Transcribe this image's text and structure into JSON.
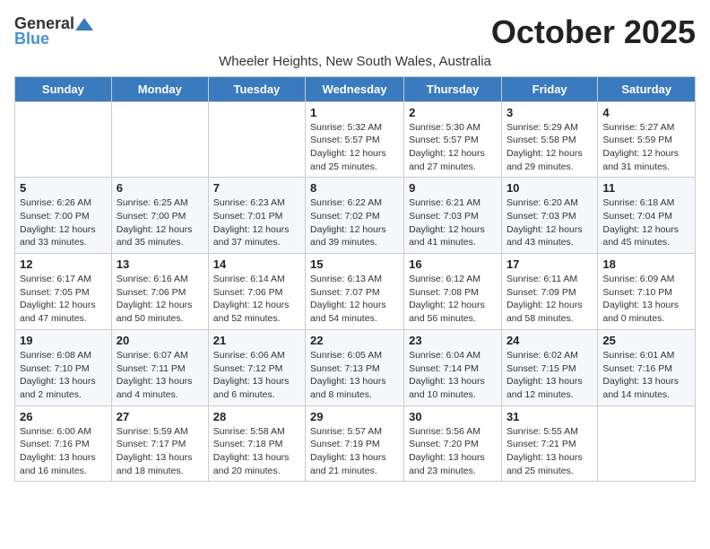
{
  "header": {
    "logo_general": "General",
    "logo_blue": "Blue",
    "month_title": "October 2025",
    "subtitle": "Wheeler Heights, New South Wales, Australia"
  },
  "weekdays": [
    "Sunday",
    "Monday",
    "Tuesday",
    "Wednesday",
    "Thursday",
    "Friday",
    "Saturday"
  ],
  "weeks": [
    [
      {
        "day": "",
        "info": ""
      },
      {
        "day": "",
        "info": ""
      },
      {
        "day": "",
        "info": ""
      },
      {
        "day": "1",
        "info": "Sunrise: 5:32 AM\nSunset: 5:57 PM\nDaylight: 12 hours\nand 25 minutes."
      },
      {
        "day": "2",
        "info": "Sunrise: 5:30 AM\nSunset: 5:57 PM\nDaylight: 12 hours\nand 27 minutes."
      },
      {
        "day": "3",
        "info": "Sunrise: 5:29 AM\nSunset: 5:58 PM\nDaylight: 12 hours\nand 29 minutes."
      },
      {
        "day": "4",
        "info": "Sunrise: 5:27 AM\nSunset: 5:59 PM\nDaylight: 12 hours\nand 31 minutes."
      }
    ],
    [
      {
        "day": "5",
        "info": "Sunrise: 6:26 AM\nSunset: 7:00 PM\nDaylight: 12 hours\nand 33 minutes."
      },
      {
        "day": "6",
        "info": "Sunrise: 6:25 AM\nSunset: 7:00 PM\nDaylight: 12 hours\nand 35 minutes."
      },
      {
        "day": "7",
        "info": "Sunrise: 6:23 AM\nSunset: 7:01 PM\nDaylight: 12 hours\nand 37 minutes."
      },
      {
        "day": "8",
        "info": "Sunrise: 6:22 AM\nSunset: 7:02 PM\nDaylight: 12 hours\nand 39 minutes."
      },
      {
        "day": "9",
        "info": "Sunrise: 6:21 AM\nSunset: 7:03 PM\nDaylight: 12 hours\nand 41 minutes."
      },
      {
        "day": "10",
        "info": "Sunrise: 6:20 AM\nSunset: 7:03 PM\nDaylight: 12 hours\nand 43 minutes."
      },
      {
        "day": "11",
        "info": "Sunrise: 6:18 AM\nSunset: 7:04 PM\nDaylight: 12 hours\nand 45 minutes."
      }
    ],
    [
      {
        "day": "12",
        "info": "Sunrise: 6:17 AM\nSunset: 7:05 PM\nDaylight: 12 hours\nand 47 minutes."
      },
      {
        "day": "13",
        "info": "Sunrise: 6:16 AM\nSunset: 7:06 PM\nDaylight: 12 hours\nand 50 minutes."
      },
      {
        "day": "14",
        "info": "Sunrise: 6:14 AM\nSunset: 7:06 PM\nDaylight: 12 hours\nand 52 minutes."
      },
      {
        "day": "15",
        "info": "Sunrise: 6:13 AM\nSunset: 7:07 PM\nDaylight: 12 hours\nand 54 minutes."
      },
      {
        "day": "16",
        "info": "Sunrise: 6:12 AM\nSunset: 7:08 PM\nDaylight: 12 hours\nand 56 minutes."
      },
      {
        "day": "17",
        "info": "Sunrise: 6:11 AM\nSunset: 7:09 PM\nDaylight: 12 hours\nand 58 minutes."
      },
      {
        "day": "18",
        "info": "Sunrise: 6:09 AM\nSunset: 7:10 PM\nDaylight: 13 hours\nand 0 minutes."
      }
    ],
    [
      {
        "day": "19",
        "info": "Sunrise: 6:08 AM\nSunset: 7:10 PM\nDaylight: 13 hours\nand 2 minutes."
      },
      {
        "day": "20",
        "info": "Sunrise: 6:07 AM\nSunset: 7:11 PM\nDaylight: 13 hours\nand 4 minutes."
      },
      {
        "day": "21",
        "info": "Sunrise: 6:06 AM\nSunset: 7:12 PM\nDaylight: 13 hours\nand 6 minutes."
      },
      {
        "day": "22",
        "info": "Sunrise: 6:05 AM\nSunset: 7:13 PM\nDaylight: 13 hours\nand 8 minutes."
      },
      {
        "day": "23",
        "info": "Sunrise: 6:04 AM\nSunset: 7:14 PM\nDaylight: 13 hours\nand 10 minutes."
      },
      {
        "day": "24",
        "info": "Sunrise: 6:02 AM\nSunset: 7:15 PM\nDaylight: 13 hours\nand 12 minutes."
      },
      {
        "day": "25",
        "info": "Sunrise: 6:01 AM\nSunset: 7:16 PM\nDaylight: 13 hours\nand 14 minutes."
      }
    ],
    [
      {
        "day": "26",
        "info": "Sunrise: 6:00 AM\nSunset: 7:16 PM\nDaylight: 13 hours\nand 16 minutes."
      },
      {
        "day": "27",
        "info": "Sunrise: 5:59 AM\nSunset: 7:17 PM\nDaylight: 13 hours\nand 18 minutes."
      },
      {
        "day": "28",
        "info": "Sunrise: 5:58 AM\nSunset: 7:18 PM\nDaylight: 13 hours\nand 20 minutes."
      },
      {
        "day": "29",
        "info": "Sunrise: 5:57 AM\nSunset: 7:19 PM\nDaylight: 13 hours\nand 21 minutes."
      },
      {
        "day": "30",
        "info": "Sunrise: 5:56 AM\nSunset: 7:20 PM\nDaylight: 13 hours\nand 23 minutes."
      },
      {
        "day": "31",
        "info": "Sunrise: 5:55 AM\nSunset: 7:21 PM\nDaylight: 13 hours\nand 25 minutes."
      },
      {
        "day": "",
        "info": ""
      }
    ]
  ]
}
